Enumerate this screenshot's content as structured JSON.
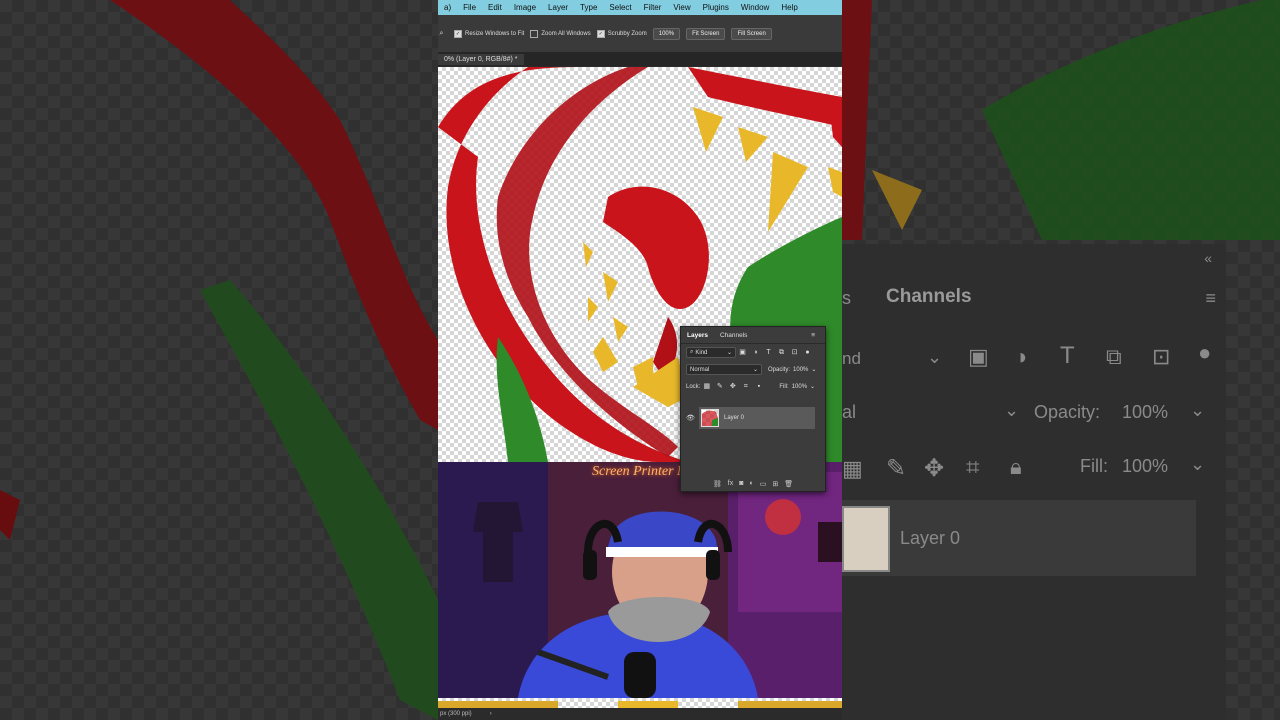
{
  "app": {
    "menu": [
      "a)",
      "File",
      "Edit",
      "Image",
      "Layer",
      "Type",
      "Select",
      "Filter",
      "View",
      "Plugins",
      "Window",
      "Help"
    ]
  },
  "options": {
    "resize_windows": "Resize Windows to Fit",
    "zoom_all": "Zoom All Windows",
    "scrubby_zoom": "Scrubby Zoom",
    "zoom_value": "100%",
    "fit_screen": "Fit Screen",
    "fill_screen": "Fill Screen",
    "resize_checked": true,
    "zoom_all_checked": false,
    "scrubby_checked": true
  },
  "document": {
    "tab_title": "0% (Layer 0, RGB/8#) *"
  },
  "layers_panel": {
    "tab_layers": "Layers",
    "tab_channels": "Channels",
    "filter_kind": "Kind",
    "blend_mode": "Normal",
    "opacity_label": "Opacity:",
    "opacity_value": "100%",
    "lock_label": "Lock:",
    "fill_label": "Fill:",
    "fill_value": "100%",
    "layer_name": "Layer 0"
  },
  "big_panel": {
    "tab_partial": "s",
    "tab_channels": "Channels",
    "kind_partial": "nd",
    "blend_partial": "al",
    "opacity_label": "Opacity:",
    "opacity_value": "100%",
    "fill_label": "Fill:",
    "fill_value": "100%",
    "layer_name": "Layer 0"
  },
  "webcam": {
    "sign_text": "Screen Printer M"
  },
  "status": {
    "text": "px (300 ppi)"
  },
  "colors": {
    "menubar": "#82cde0",
    "red": "#c8141a",
    "green": "#2f8a2a",
    "yellow": "#e8b82a"
  }
}
